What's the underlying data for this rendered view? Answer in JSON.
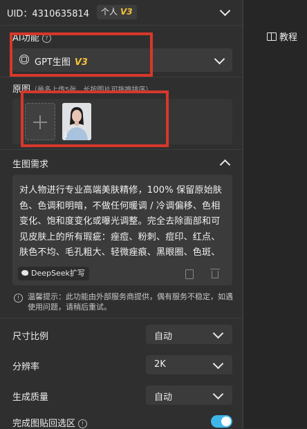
{
  "header": {
    "uid": "UID：4310635814",
    "account_type": "个人",
    "vip_level": "V3"
  },
  "ai_function": {
    "label": "AI功能",
    "tutorial_label": "教程",
    "model": "GPT生图",
    "model_level": "V3"
  },
  "source_image": {
    "label": "原图",
    "hint": "（最多上传5张，长按图片可拖拽排序）",
    "images": [
      {
        "index": "1"
      }
    ]
  },
  "prompt": {
    "label": "生图需求",
    "text": "对人物进行专业高端美肤精修，100% 保留原始肤色、色调和明暗，不做任何暖调 / 冷调偏移、色相变化、饱和度变化或曝光调整。完全去除面部和可见皮肤上的所有瑕疵：痤痘、粉刺、痘印、红点、肤色不均、毛孔粗大、轻微痤痕、黑眼圈、色斑、同时保留自然皮肤纹理 / 保留真实",
    "deepseek_label": "DeepSeek扩写"
  },
  "notice": "温馨提示：此功能由外部服务商提供，偶有服务不稳定，如遇使用问题，请稍后重试。",
  "options": [
    {
      "label": "尺寸比例",
      "value": "自动"
    },
    {
      "label": "分辨率",
      "value": "2K"
    },
    {
      "label": "生成质量",
      "value": "自动"
    }
  ],
  "paste_back": {
    "label": "完成图贴回选区",
    "enabled": true
  },
  "colors": {
    "accent_gold": "#f3c13a",
    "highlight_red": "#d6382b",
    "toggle_blue": "#3fb6ea"
  }
}
